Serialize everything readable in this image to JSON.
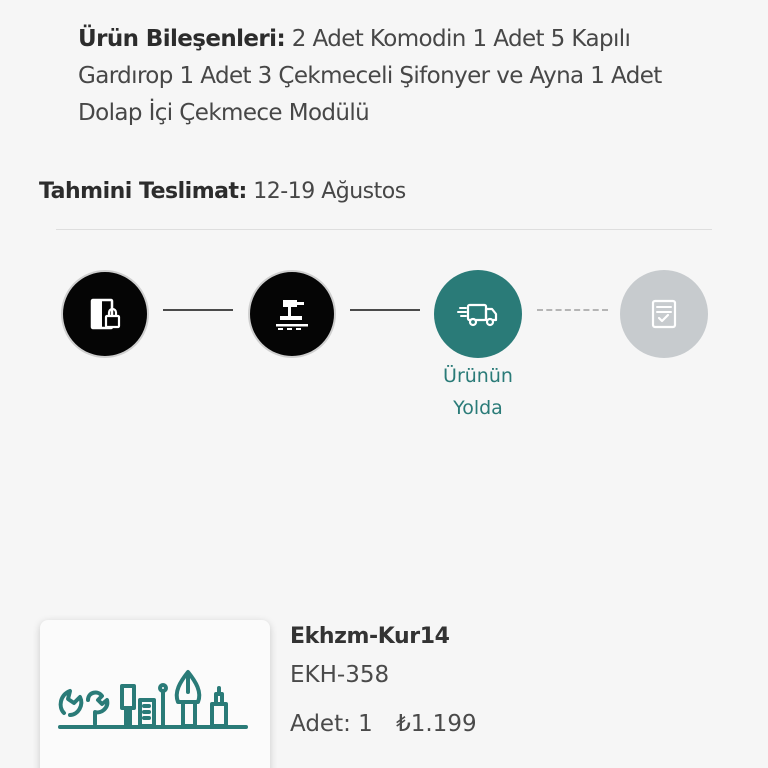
{
  "components": {
    "label": "Ürün Bileşenleri:",
    "text": "2 Adet Komodin 1 Adet 5 Kapılı Gardırop 1 Adet 3 Çekmeceli Şifonyer ve Ayna 1 Adet Dolap İçi Çekmece Modülü"
  },
  "delivery": {
    "label": "Tahmini Teslimat:",
    "value": "12-19 Ağustos"
  },
  "tracker": {
    "steps": [
      {
        "icon": "order-lock-icon",
        "state": "done"
      },
      {
        "icon": "production-icon",
        "state": "done"
      },
      {
        "icon": "delivery-truck-icon",
        "state": "active",
        "label": "Ürünün Yolda"
      },
      {
        "icon": "checklist-icon",
        "state": "pending"
      }
    ]
  },
  "colors": {
    "accent": "#2a7b78",
    "done": "#050505",
    "pending": "#c7cbce"
  },
  "product": {
    "image_icon": "tools-illustration-icon",
    "name": "Ekhzm-Kur14",
    "code": "EKH-358",
    "qty_label": "Adet: 1",
    "price": "₺1.199"
  }
}
